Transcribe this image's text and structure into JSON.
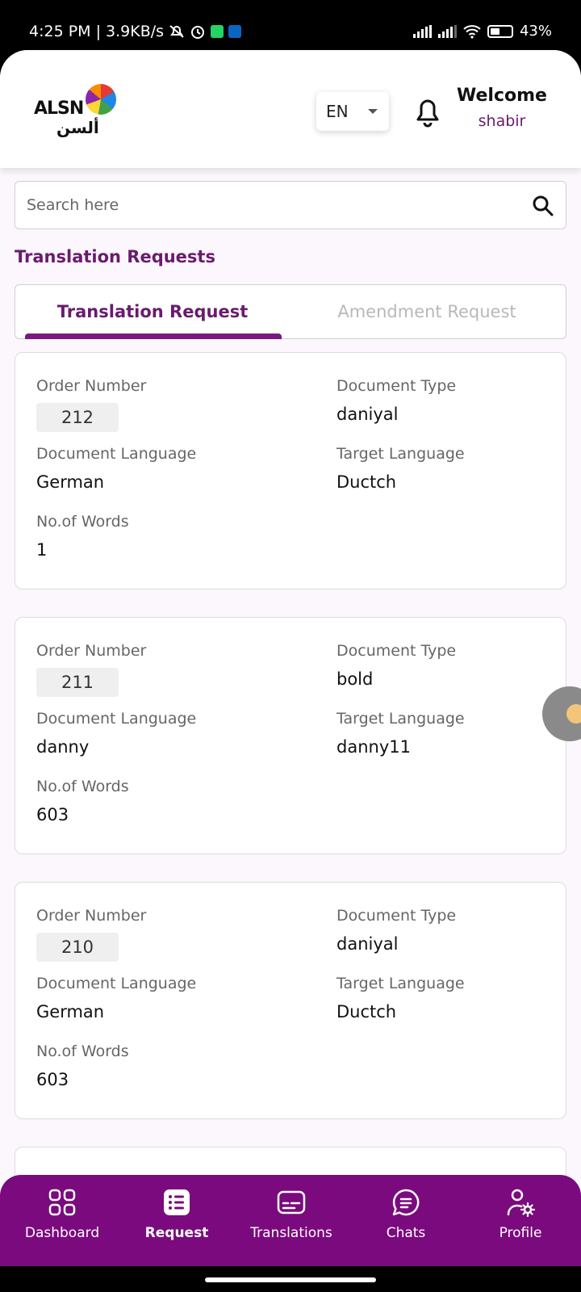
{
  "status_bar": {
    "time_speed": "4:25 PM | 3.9KB/s",
    "battery": "43%"
  },
  "header": {
    "logo_text_en": "ALSN",
    "logo_text_ar": "ألسن",
    "language": "EN",
    "welcome_title": "Welcome",
    "user_name": "shabir"
  },
  "search": {
    "placeholder": "Search here"
  },
  "section_title": "Translation Requests",
  "tabs": [
    {
      "label": "Translation Request",
      "active": true
    },
    {
      "label": "Amendment Request",
      "active": false
    }
  ],
  "labels": {
    "order_number": "Order Number",
    "document_type": "Document Type",
    "document_language": "Document Language",
    "target_language": "Target Language",
    "no_of_words": "No.of Words"
  },
  "requests": [
    {
      "order_number": "212",
      "document_type": "daniyal",
      "document_language": "German",
      "target_language": "Ductch",
      "no_of_words": "1"
    },
    {
      "order_number": "211",
      "document_type": "bold",
      "document_language": "danny",
      "target_language": "danny11",
      "no_of_words": "603"
    },
    {
      "order_number": "210",
      "document_type": "daniyal",
      "document_language": "German",
      "target_language": "Ductch",
      "no_of_words": "603"
    }
  ],
  "bottom_nav": [
    {
      "label": "Dashboard",
      "icon": "grid-icon"
    },
    {
      "label": "Request",
      "icon": "list-icon",
      "active": true
    },
    {
      "label": "Translations",
      "icon": "subtitles-icon"
    },
    {
      "label": "Chats",
      "icon": "chat-icon"
    },
    {
      "label": "Profile",
      "icon": "profile-settings-icon"
    }
  ],
  "colors": {
    "brand_purple": "#7b0a7e",
    "title_purple": "#6a1b6e"
  }
}
